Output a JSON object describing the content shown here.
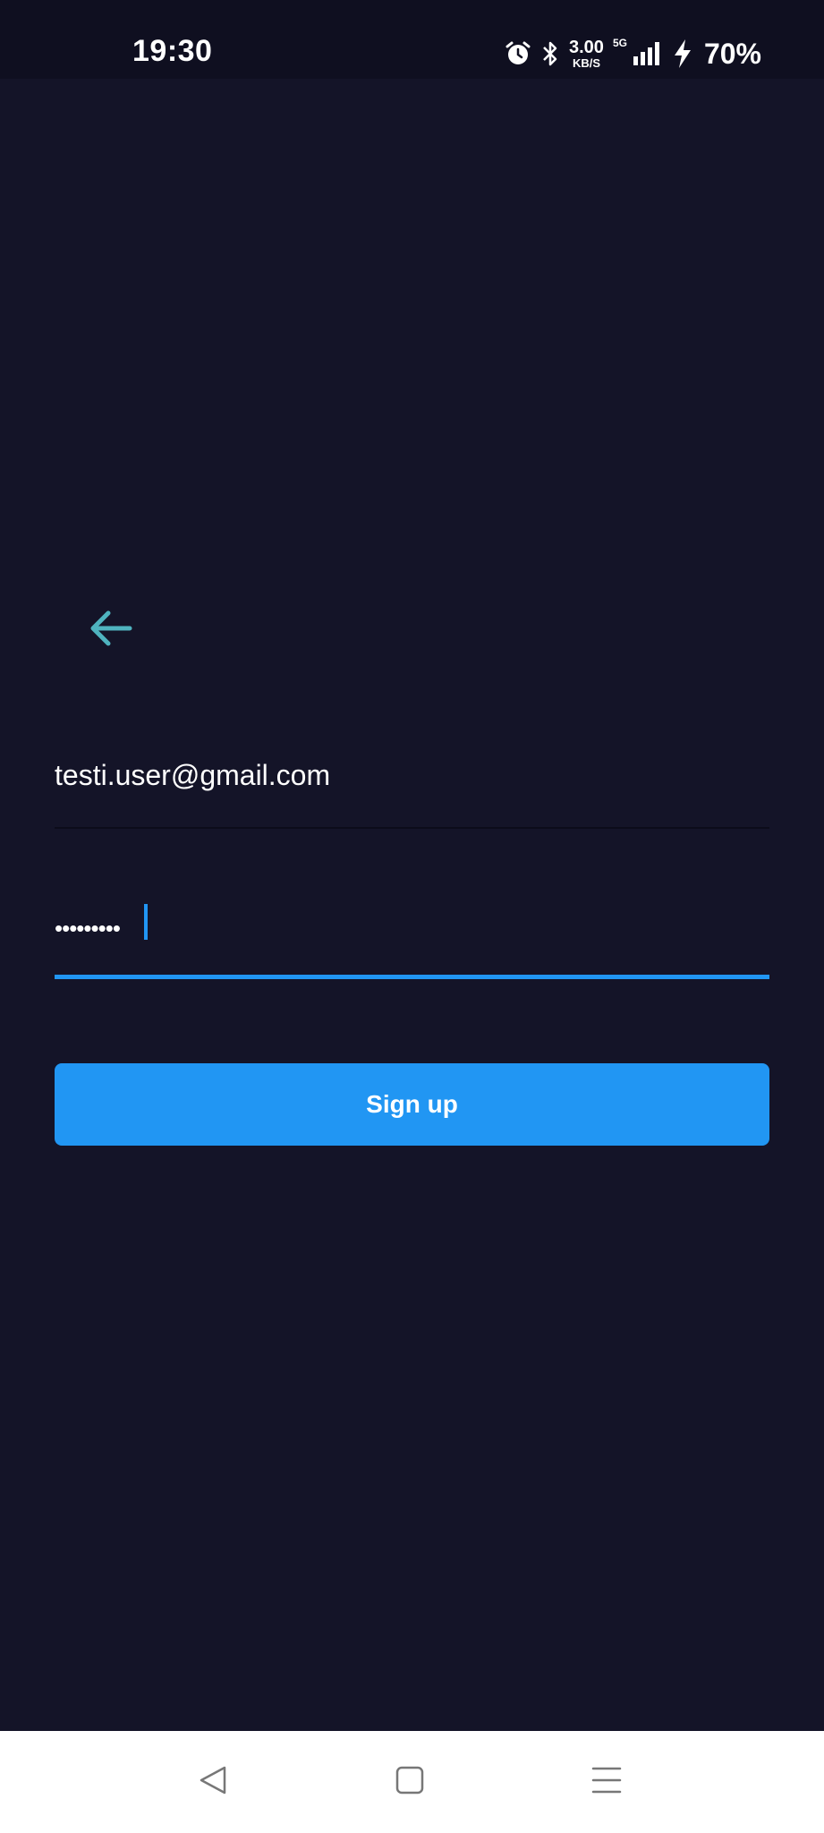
{
  "status_bar": {
    "time": "19:30",
    "net_speed_value": "3.00",
    "net_speed_unit": "KB/S",
    "network_gen": "5G",
    "battery": "70%",
    "icons": [
      "alarm-icon",
      "bluetooth-icon",
      "signal-icon",
      "charging-icon"
    ]
  },
  "form": {
    "email_value": "testi.user@gmail.com",
    "password_masked": "•••••••••",
    "signup_label": "Sign up"
  },
  "colors": {
    "background": "#141428",
    "accent": "#2196f3",
    "back_arrow": "#4fb3bf"
  },
  "nav_bar": {
    "icons": [
      "nav-back-icon",
      "nav-home-icon",
      "nav-recents-icon"
    ]
  }
}
